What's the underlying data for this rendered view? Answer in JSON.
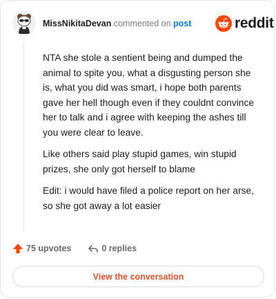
{
  "header": {
    "username": "MissNikitaDevan",
    "commented_on": "commented on",
    "post_link": "post",
    "logo_text": "reddit",
    "logo_color": "#ff4500",
    "avatar_icon": "snoo-avatar-icon"
  },
  "comment": {
    "paragraphs": [
      "NTA she stole a sentient being and dumped the animal to spite you, what a disgusting person she is, what you did was smart, i hope both parents gave her hell though even if they couldnt convince her to talk and i agree with keeping the ashes till you were clear to leave.",
      "Like others said play stupid games, win stupid prizes, she only got herself to blame",
      "Edit: i would have filed a police report on her arse, so she got away a lot easier"
    ]
  },
  "actions": {
    "upvotes": "75 upvotes",
    "replies": "0 replies",
    "upvote_color": "#ff4500"
  },
  "cta": {
    "label": "View the conversation",
    "color": "#e2512b"
  }
}
